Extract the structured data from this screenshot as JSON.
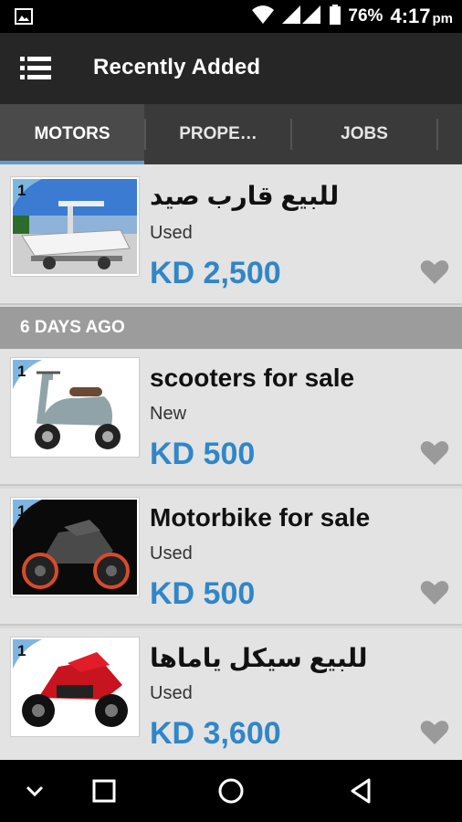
{
  "status_bar": {
    "battery": "76%",
    "time": "4:17",
    "ampm": "pm"
  },
  "app_bar": {
    "title": "Recently Added"
  },
  "tabs": [
    {
      "label": "MOTORS",
      "active": true
    },
    {
      "label": "PROPE…",
      "active": false
    },
    {
      "label": "JOBS",
      "active": false
    }
  ],
  "section_header": "6 DAYS AGO",
  "listings": [
    {
      "badge": "1",
      "title": "للبيع قارب صيد",
      "condition": "Used",
      "price": "KD 2,500",
      "image": "boat"
    },
    {
      "badge": "1",
      "title": "scooters for sale",
      "condition": "New",
      "price": "KD 500",
      "image": "scooter"
    },
    {
      "badge": "1",
      "title": "Motorbike for sale",
      "condition": "Used",
      "price": "KD 500",
      "image": "motorbike-grey"
    },
    {
      "badge": "1",
      "title": "للبيع سيكل ياماها",
      "condition": "Used",
      "price": "KD 3,600",
      "image": "motorbike-red"
    }
  ],
  "colors": {
    "price": "#2f86c8",
    "tab_indicator": "#5a9fd0",
    "app_bar": "#262626"
  },
  "icons": [
    "image-icon",
    "wifi-icon",
    "signal-icon",
    "battery-icon",
    "menu-icon",
    "heart-icon",
    "back-icon",
    "home-icon",
    "recents-icon",
    "chevron-down-icon"
  ]
}
